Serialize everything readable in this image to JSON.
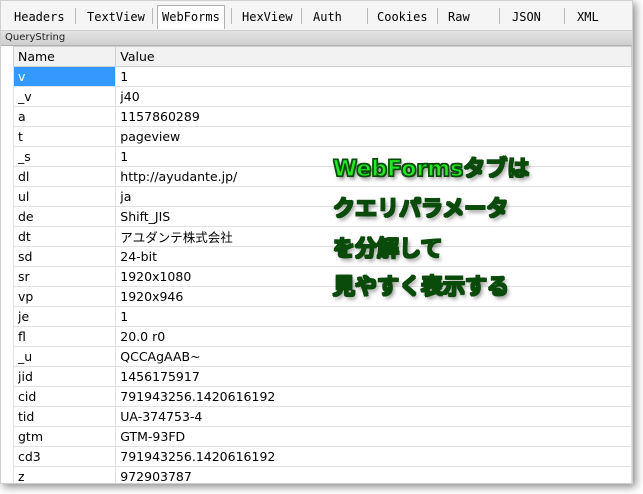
{
  "tabs": [
    {
      "label": "Headers"
    },
    {
      "label": "TextView"
    },
    {
      "label": "WebForms"
    },
    {
      "label": "HexView"
    },
    {
      "label": "Auth"
    },
    {
      "label": "Cookies"
    },
    {
      "label": "Raw"
    },
    {
      "label": "JSON"
    },
    {
      "label": "XML"
    }
  ],
  "active_tab": "WebForms",
  "section_title": "QueryString",
  "table": {
    "columns": [
      "Name",
      "Value"
    ],
    "rows": [
      {
        "name": "v",
        "value": "1"
      },
      {
        "name": "_v",
        "value": "j40"
      },
      {
        "name": "a",
        "value": "1157860289"
      },
      {
        "name": "t",
        "value": "pageview"
      },
      {
        "name": "_s",
        "value": "1"
      },
      {
        "name": "dl",
        "value": "http://ayudante.jp/"
      },
      {
        "name": "ul",
        "value": "ja"
      },
      {
        "name": "de",
        "value": "Shift_JIS"
      },
      {
        "name": "dt",
        "value": "アユダンテ株式会社"
      },
      {
        "name": "sd",
        "value": "24-bit"
      },
      {
        "name": "sr",
        "value": "1920x1080"
      },
      {
        "name": "vp",
        "value": "1920x946"
      },
      {
        "name": "je",
        "value": "1"
      },
      {
        "name": "fl",
        "value": "20.0 r0"
      },
      {
        "name": "_u",
        "value": "QCCAgAAB~"
      },
      {
        "name": "jid",
        "value": "1456175917"
      },
      {
        "name": "cid",
        "value": "791943256.1420616192"
      },
      {
        "name": "tid",
        "value": "UA-374753-4"
      },
      {
        "name": "gtm",
        "value": "GTM-93FD"
      },
      {
        "name": "cd3",
        "value": "791943256.1420616192"
      },
      {
        "name": "z",
        "value": "972903787"
      }
    ],
    "selected_row": 0
  },
  "annotation": {
    "lines": [
      "WebFormsタブは",
      "クエリパラメータ",
      "を分解して",
      "見やすく表示する"
    ],
    "color": "#22e822"
  },
  "colors": {
    "selection": "#3399ff"
  }
}
